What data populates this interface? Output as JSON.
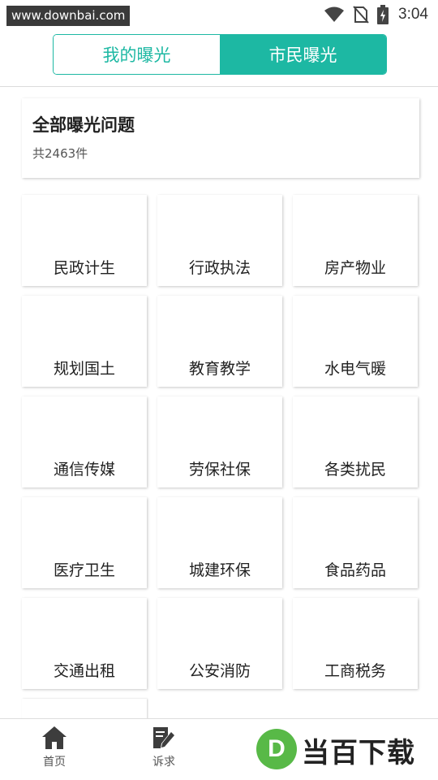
{
  "status_bar": {
    "watermark_url": "www.downbai.com",
    "time": "3:04"
  },
  "segments": {
    "mine": "我的曝光",
    "citizen": "市民曝光",
    "active": "citizen"
  },
  "summary": {
    "title": "全部曝光问题",
    "count": "共2463件"
  },
  "categories": [
    "民政计生",
    "行政执法",
    "房产物业",
    "规划国土",
    "教育教学",
    "水电气暖",
    "通信传媒",
    "劳保社保",
    "各类扰民",
    "医疗卫生",
    "城建环保",
    "食品药品",
    "交通出租",
    "公安消防",
    "工商税务"
  ],
  "bottom_nav": {
    "home": "首页",
    "complaint": "诉求"
  },
  "brand": {
    "letter": "D",
    "name": "当百下载"
  },
  "colors": {
    "accent": "#1db8a3",
    "brand_green": "#58b947"
  },
  "icons": {
    "wifi": "wifi-icon",
    "no_sim": "no-sim-icon",
    "battery": "battery-charging-icon",
    "home": "home-icon",
    "complaint": "edit-document-icon"
  }
}
